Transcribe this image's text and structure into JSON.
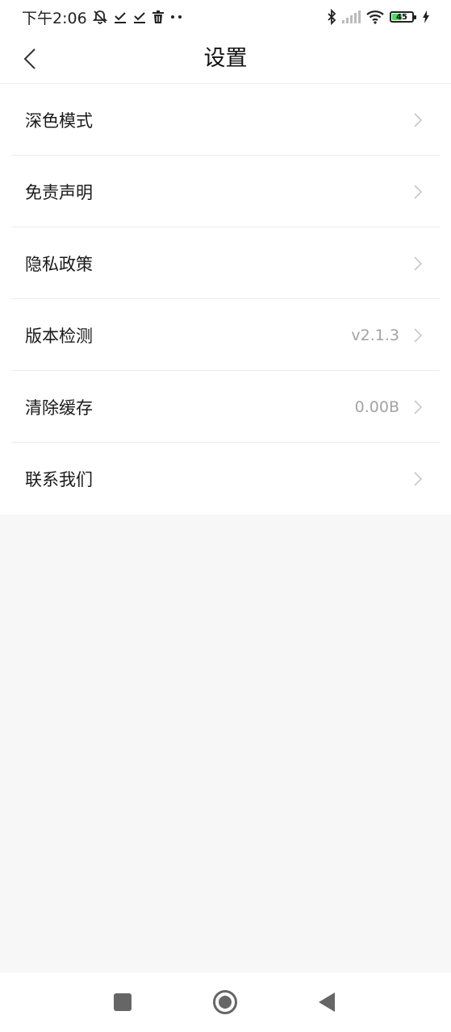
{
  "status_bar": {
    "time": "下午2:06",
    "battery_level": "45",
    "icons": [
      "bell-off-icon",
      "check-download-icon",
      "check-download-icon",
      "trash-icon",
      "more-dots-icon",
      "bluetooth-icon",
      "signal-icon",
      "wifi-icon",
      "battery-icon",
      "charging-icon"
    ]
  },
  "header": {
    "title": "设置",
    "back_icon": "chevron-left-icon"
  },
  "settings": {
    "items": [
      {
        "label": "深色模式",
        "value": ""
      },
      {
        "label": "免责声明",
        "value": ""
      },
      {
        "label": "隐私政策",
        "value": ""
      },
      {
        "label": "版本检测",
        "value": "v2.1.3"
      },
      {
        "label": "清除缓存",
        "value": "0.00B"
      },
      {
        "label": "联系我们",
        "value": ""
      }
    ]
  },
  "system_nav": {
    "icons": [
      "recents-square-icon",
      "home-circle-icon",
      "back-triangle-icon"
    ]
  },
  "colors": {
    "background": "#f7f7f7",
    "surface": "#ffffff",
    "secondary_text": "#a3a3a3",
    "divider": "#ececec"
  }
}
